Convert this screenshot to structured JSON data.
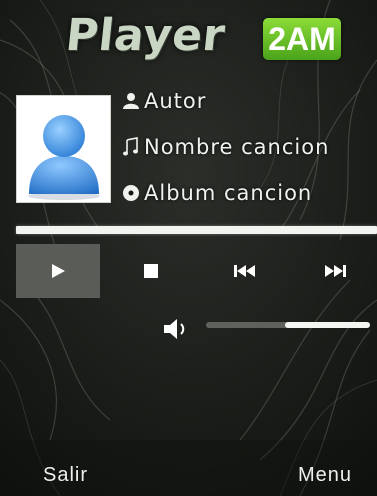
{
  "logo": {
    "word": "Player",
    "badge": "2AM"
  },
  "track": {
    "author": "Autor",
    "song": "Nombre cancion",
    "album": "Album cancion",
    "author_icon": "person-icon",
    "song_icon": "music-note-icon",
    "album_icon": "disc-icon"
  },
  "progress": {
    "value": 1.0
  },
  "controls": {
    "play_icon": "play-icon",
    "stop_icon": "stop-icon",
    "prev_icon": "previous-icon",
    "next_icon": "next-icon"
  },
  "volume": {
    "icon": "speaker-icon",
    "level": 0.52
  },
  "softkeys": {
    "left": "Salir",
    "right": "Menu"
  },
  "colors": {
    "badge": "#5cb82a",
    "background": "#141613",
    "text": "#eef0ec"
  }
}
